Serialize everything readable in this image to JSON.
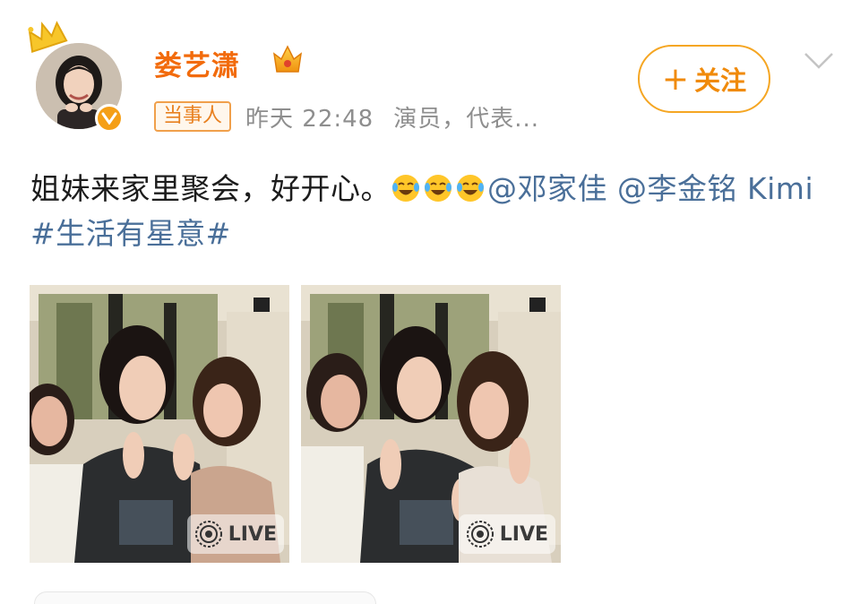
{
  "post": {
    "username": "娄艺潇",
    "badge": "当事人",
    "timestamp": "昨天 22:48",
    "profession": "演员，代表...",
    "follow_label": "关注",
    "text_plain": "姐妹来家里聚会，好开心。",
    "mention_1": "@邓家佳",
    "mention_2": "@李金铭 Kimi",
    "hashtag": "#生活有星意#",
    "emoji_count": 3
  },
  "photos": [
    {
      "live_label": "LIVE"
    },
    {
      "live_label": "LIVE"
    }
  ],
  "colors": {
    "username": "#f26b0c",
    "accent": "#f5a623",
    "link": "#4a6f99",
    "meta": "#8e8e8e"
  },
  "icons": [
    "crown-icon",
    "verified-icon",
    "vip-crown-icon",
    "chevron-down-icon",
    "laugh-cry-emoji",
    "live-icon"
  ]
}
